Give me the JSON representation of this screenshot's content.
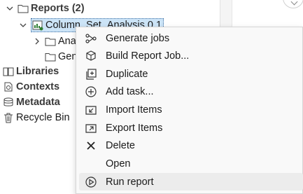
{
  "tree": {
    "reports": {
      "label": "Reports (2)"
    },
    "column_set": {
      "label": "Column_Set_Analysis 0.1"
    },
    "child1": {
      "label": "Ana"
    },
    "child2": {
      "label": "Gen"
    },
    "libraries": {
      "label": "Libraries"
    },
    "contexts": {
      "label": "Contexts"
    },
    "metadata": {
      "label": "Metadata"
    },
    "recycle_bin": {
      "label": "Recycle Bin"
    }
  },
  "menu": {
    "items": [
      {
        "label": "Generate jobs",
        "icon": "generate-jobs-icon"
      },
      {
        "label": "Build Report Job...",
        "icon": "build-job-icon"
      },
      {
        "label": "Duplicate",
        "icon": "duplicate-icon"
      },
      {
        "label": "Add task...",
        "icon": "add-circle-icon"
      },
      {
        "label": "Import Items",
        "icon": "import-icon"
      },
      {
        "label": "Export Items",
        "icon": "export-icon"
      },
      {
        "label": "Delete",
        "icon": "delete-x-icon"
      },
      {
        "label": "Open",
        "icon": ""
      },
      {
        "label": "Run report",
        "icon": "run-icon"
      }
    ]
  }
}
